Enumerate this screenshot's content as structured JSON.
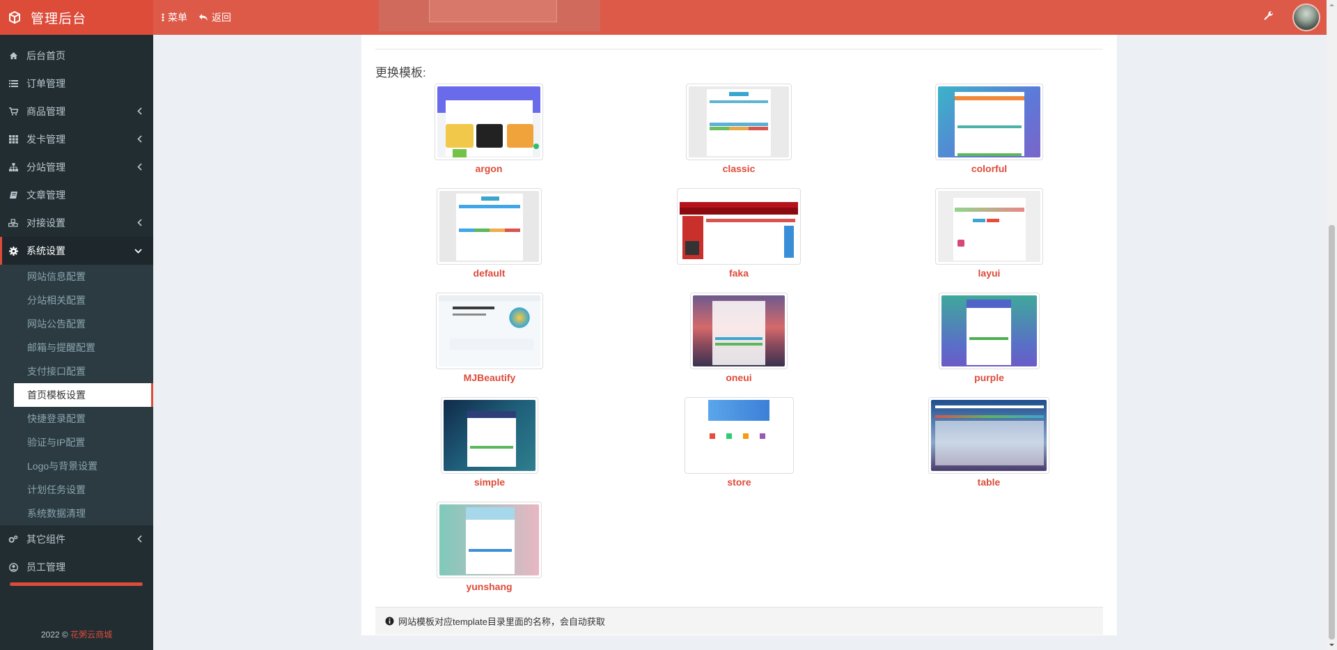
{
  "header": {
    "brand": "管理后台",
    "menu_label": "菜单",
    "back_label": "返回"
  },
  "sidebar": {
    "items": [
      {
        "label": "后台首页",
        "icon": "home-icon"
      },
      {
        "label": "订单管理",
        "icon": "list-icon"
      },
      {
        "label": "商品管理",
        "icon": "cart-icon"
      },
      {
        "label": "发卡管理",
        "icon": "grid-icon"
      },
      {
        "label": "分站管理",
        "icon": "sitemap-icon"
      },
      {
        "label": "文章管理",
        "icon": "book-icon"
      },
      {
        "label": "对接设置",
        "icon": "cubes-icon"
      },
      {
        "label": "系统设置",
        "icon": "gear-icon"
      }
    ],
    "subitems": [
      "网站信息配置",
      "分站相关配置",
      "网站公告配置",
      "邮箱与提醒配置",
      "支付接口配置",
      "首页模板设置",
      "快捷登录配置",
      "验证与IP配置",
      "Logo与背景设置",
      "计划任务设置",
      "系统数据清理"
    ],
    "bottom_items": [
      {
        "label": "其它组件",
        "icon": "cogs-icon"
      },
      {
        "label": "员工管理",
        "icon": "user-circle-icon"
      }
    ],
    "footer_year": "2022 ©",
    "footer_link": "花粥云商城"
  },
  "main": {
    "section_title": "更换模板:",
    "templates": [
      "argon",
      "classic",
      "colorful",
      "default",
      "faka",
      "layui",
      "MJBeautify",
      "oneui",
      "purple",
      "simple",
      "store",
      "table",
      "yunshang"
    ],
    "note": "网站模板对应template目录里面的名称，会自动获取"
  },
  "colors": {
    "accent": "#dd4b39",
    "header": "#dd5a49",
    "sidebar": "#222d32"
  }
}
